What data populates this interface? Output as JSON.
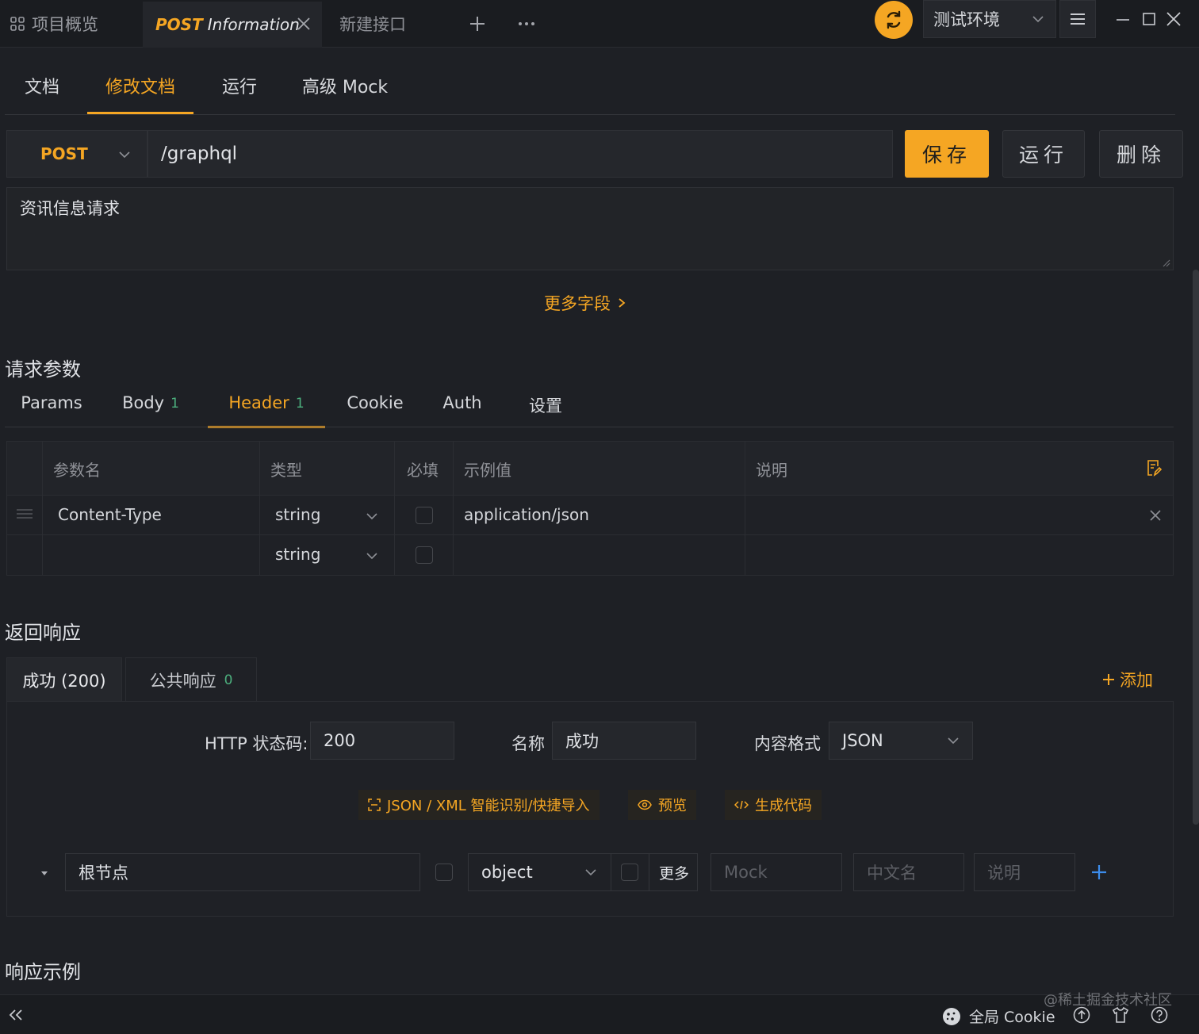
{
  "tabs": {
    "overview": "项目概览",
    "active_method": "POST",
    "active_name": "Information",
    "new_tab": "新建接口"
  },
  "env": {
    "selected": "测试环境"
  },
  "doc_tabs": [
    "文档",
    "修改文档",
    "运行",
    "高级 Mock"
  ],
  "request": {
    "method": "POST",
    "url": "/graphql",
    "save": "保存",
    "run": "运行",
    "delete": "删除",
    "description": "资讯信息请求",
    "more_fields": "更多字段"
  },
  "params_section": {
    "title": "请求参数",
    "tabs": [
      {
        "label": "Params",
        "count": ""
      },
      {
        "label": "Body",
        "count": "1"
      },
      {
        "label": "Header",
        "count": "1"
      },
      {
        "label": "Cookie",
        "count": ""
      },
      {
        "label": "Auth",
        "count": ""
      },
      {
        "label": "设置",
        "count": ""
      }
    ],
    "columns": [
      "参数名",
      "类型",
      "必填",
      "示例值",
      "说明"
    ],
    "rows": [
      {
        "name": "Content-Type",
        "type": "string",
        "example": "application/json"
      },
      {
        "name": "",
        "type": "string",
        "example": ""
      }
    ]
  },
  "response_section": {
    "title": "返回响应",
    "tabs": [
      {
        "label": "成功 (200)"
      },
      {
        "label": "公共响应",
        "count": "0"
      }
    ],
    "add": "添加",
    "status_label": "HTTP 状态码:",
    "status_value": "200",
    "name_label": "名称",
    "name_value": "成功",
    "format_label": "内容格式",
    "format_value": "JSON",
    "tools": {
      "import": "JSON / XML 智能识别/快捷导入",
      "preview": "预览",
      "codegen": "生成代码"
    },
    "schema": {
      "root": "根节点",
      "type": "object",
      "more": "更多",
      "mock_placeholder": "Mock",
      "cn_placeholder": "中文名",
      "desc_placeholder": "说明"
    }
  },
  "example_title": "响应示例",
  "statusbar": {
    "cookie": "全局 Cookie"
  },
  "watermark": "@稀土掘金技术社区",
  "colors": {
    "accent": "#f5a623",
    "count": "#4caf7d",
    "bg": "#1e2025"
  }
}
